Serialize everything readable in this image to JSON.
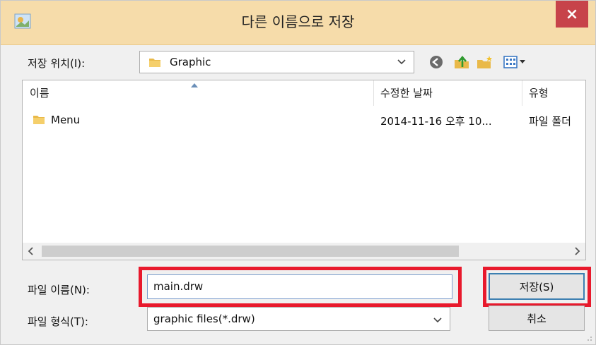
{
  "window": {
    "title": "다른 이름으로 저장",
    "close_label": "×"
  },
  "lookin": {
    "label": "저장 위치(I):",
    "value": "Graphic"
  },
  "toolbar": {
    "icons": [
      "back-icon",
      "up-folder-icon",
      "new-folder-icon",
      "view-menu-icon"
    ]
  },
  "list": {
    "columns": [
      "이름",
      "수정한 날짜",
      "유형"
    ],
    "rows": [
      {
        "name": "Menu",
        "date": "2014-11-16 오후 10...",
        "type": "파일 폴더"
      }
    ]
  },
  "filename": {
    "label": "파일 이름(N):",
    "value": "main.drw"
  },
  "filetype": {
    "label": "파일 형식(T):",
    "value": "graphic files(*.drw)"
  },
  "buttons": {
    "save": "저장(S)",
    "cancel": "취소"
  },
  "colors": {
    "titlebar": "#f6dcaa",
    "close": "#c7434a",
    "highlight": "#e8192c"
  }
}
